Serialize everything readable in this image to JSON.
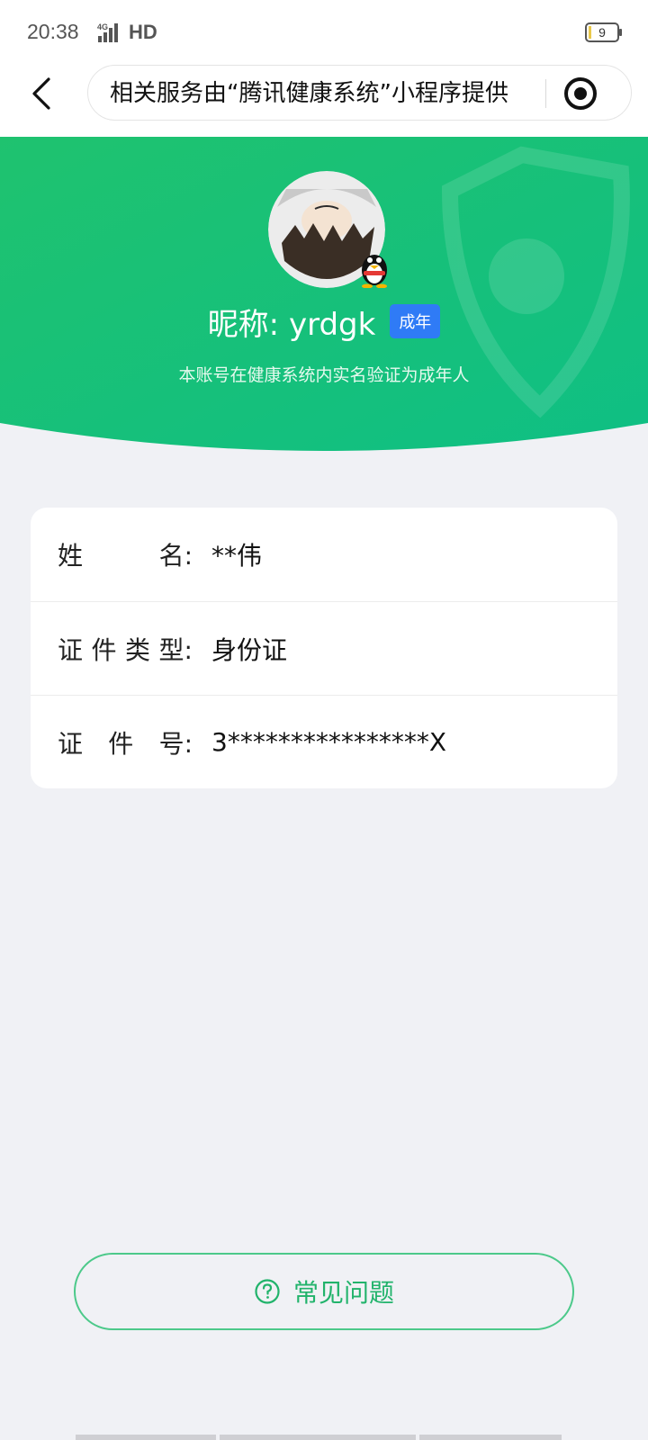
{
  "status_bar": {
    "time": "20:38",
    "network": "4G",
    "hd": "HD",
    "battery_level": "9"
  },
  "nav": {
    "title": "相关服务由“腾讯健康系统”小程序提供"
  },
  "hero": {
    "nickname": "昵称: yrdgk",
    "badge": "成年",
    "description": "本账号在健康系统内实名验证为成年人",
    "colors": {
      "start": "#1fc26f",
      "end": "#0fbf84"
    }
  },
  "info": {
    "rows": [
      {
        "label_chars": [
          "姓",
          "名:"
        ],
        "value": "**伟"
      },
      {
        "label_chars": [
          "证",
          "件",
          "类",
          "型:"
        ],
        "value": "身份证"
      },
      {
        "label_chars": [
          "证",
          "件",
          "号:"
        ],
        "value": "3****************X"
      }
    ]
  },
  "faq": {
    "label": "常见问题",
    "color": "#21b36b"
  }
}
